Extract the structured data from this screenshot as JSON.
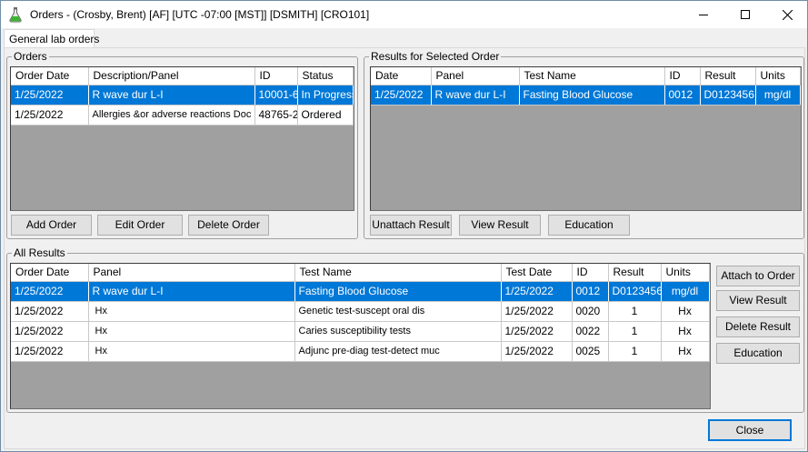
{
  "window": {
    "title": "Orders -  (Crosby, Brent) [AF] [UTC -07:00 [MST]] [DSMITH] [CRO101]",
    "icon": "flask-icon"
  },
  "tabs": [
    {
      "label": "General lab orders"
    }
  ],
  "orders": {
    "group_label": "Orders",
    "columns": [
      "Order Date",
      "Description/Panel",
      "ID",
      "Status"
    ],
    "rows": [
      {
        "date": "1/25/2022",
        "description": "R wave dur L-I",
        "id": "10001-6",
        "status": "In Progress",
        "selected": true
      },
      {
        "date": "1/25/2022",
        "description": "Allergies &or adverse reactions Doc",
        "id": "48765-2",
        "status": "Ordered",
        "selected": false
      }
    ],
    "buttons": {
      "add": "Add Order",
      "edit": "Edit Order",
      "delete": "Delete Order"
    }
  },
  "selected_results": {
    "group_label": "Results for Selected Order",
    "columns": [
      "Date",
      "Panel",
      "Test Name",
      "ID",
      "Result",
      "Units"
    ],
    "rows": [
      {
        "date": "1/25/2022",
        "panel": "R wave dur L-I",
        "test": "Fasting Blood Glucose",
        "id": "0012",
        "result": "D0123456",
        "units": "mg/dl",
        "selected": true
      }
    ],
    "buttons": {
      "unattach": "Unattach Result",
      "view": "View Result",
      "education": "Education"
    }
  },
  "all_results": {
    "group_label": "All Results",
    "columns": [
      "Order Date",
      "Panel",
      "Test Name",
      "Test Date",
      "ID",
      "Result",
      "Units"
    ],
    "rows": [
      {
        "date": "1/25/2022",
        "panel": "R wave dur L-I",
        "test": "Fasting Blood Glucose",
        "test_date": "1/25/2022",
        "id": "0012",
        "result": "D0123456",
        "units": "mg/dl",
        "selected": true
      },
      {
        "date": "1/25/2022",
        "panel": "Hx",
        "test": "Genetic test-suscept oral dis",
        "test_date": "1/25/2022",
        "id": "0020",
        "result": "1",
        "units": "Hx",
        "selected": false
      },
      {
        "date": "1/25/2022",
        "panel": "Hx",
        "test": "Caries susceptibility tests",
        "test_date": "1/25/2022",
        "id": "0022",
        "result": "1",
        "units": "Hx",
        "selected": false
      },
      {
        "date": "1/25/2022",
        "panel": "Hx",
        "test": "Adjunc pre-diag test-detect muc",
        "test_date": "1/25/2022",
        "id": "0025",
        "result": "1",
        "units": "Hx",
        "selected": false
      }
    ],
    "buttons": {
      "attach": "Attach to Order",
      "view": "View Result",
      "delete": "Delete Result",
      "education": "Education"
    }
  },
  "footer": {
    "close": "Close"
  },
  "colors": {
    "selection": "#0078d7",
    "grid_background": "#a0a0a0"
  }
}
